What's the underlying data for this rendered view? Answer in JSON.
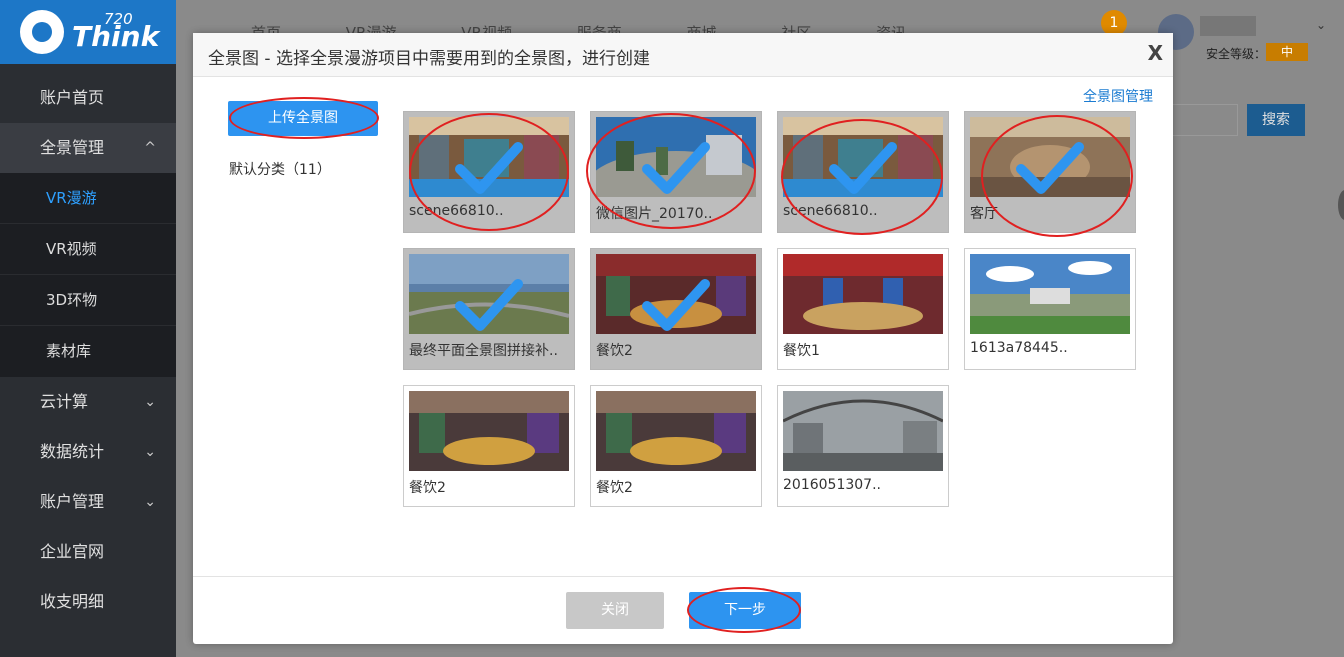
{
  "logo": {
    "number": "720",
    "word": "Think"
  },
  "sidebar": {
    "items": [
      {
        "label": "账户首页"
      },
      {
        "label": "全景管理",
        "chevron": "^"
      },
      {
        "label": "VR漫游"
      },
      {
        "label": "VR视频"
      },
      {
        "label": "3D环物"
      },
      {
        "label": "素材库"
      },
      {
        "label": "云计算",
        "chevron": "⌄"
      },
      {
        "label": "数据统计",
        "chevron": "⌄"
      },
      {
        "label": "账户管理",
        "chevron": "⌄"
      },
      {
        "label": "企业官网"
      },
      {
        "label": "收支明细"
      }
    ]
  },
  "topbar": {
    "nav": [
      "首页",
      "VR漫游",
      "VR视频",
      "服务商",
      "商城",
      "社区",
      "资讯"
    ],
    "notification_count": "1",
    "safety_label": "安全等级：",
    "safety_level": "中",
    "user_chevron": "⌄"
  },
  "background": {
    "search_label": "搜索"
  },
  "modal": {
    "title": "全景图 - 选择全景漫游项目中需要用到的全景图，进行创建",
    "close": "X",
    "upload_label": "上传全景图",
    "category": "默认分类（11）",
    "manage_link": "全景图管理",
    "images": [
      {
        "label": "scene66810..",
        "selected": true
      },
      {
        "label": "微信图片_20170..",
        "selected": true
      },
      {
        "label": "scene66810..",
        "selected": true
      },
      {
        "label": "客厅",
        "selected": true
      },
      {
        "label": "最终平面全景图拼接补..",
        "selected": true
      },
      {
        "label": "餐饮2",
        "selected": true
      },
      {
        "label": "餐饮1",
        "selected": false
      },
      {
        "label": "1613a78445..",
        "selected": false
      },
      {
        "label": "餐饮2",
        "selected": false
      },
      {
        "label": "餐饮2",
        "selected": false
      },
      {
        "label": "2016051307..",
        "selected": false
      }
    ],
    "footer": {
      "close_label": "关闭",
      "next_label": "下一步"
    }
  },
  "colors": {
    "accent": "#2d94f0",
    "sidebar_bg": "#2b2e33",
    "logo_bg": "#1d77c7",
    "annotation": "#e02020",
    "active_nav": "#2ea0ff"
  }
}
